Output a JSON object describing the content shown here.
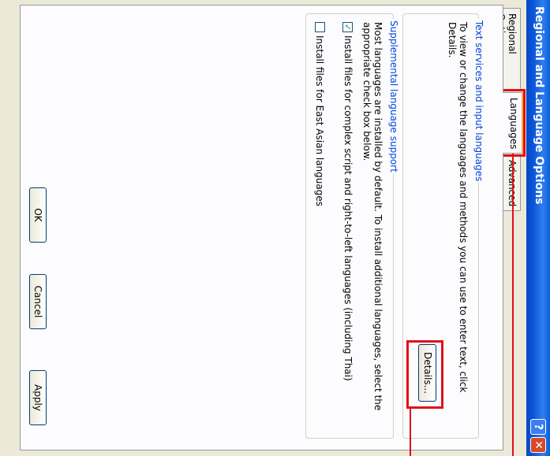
{
  "window": {
    "title": "Regional and Language Options",
    "help_glyph": "?",
    "close_glyph": "✕"
  },
  "tabs": [
    {
      "label": "Regional Options"
    },
    {
      "label": "Languages"
    },
    {
      "label": "Advanced"
    }
  ],
  "text_services": {
    "title": "Text services and input languages",
    "description": "To view or change the languages and methods you can use to enter text, click Details.",
    "details_button": "Details..."
  },
  "supplemental": {
    "title": "Supplemental language support",
    "description": "Most languages are installed by default. To install additional languages, select the appropriate check box below.",
    "complex_script_label": "Install files for complex script and right-to-left languages (including Thai)",
    "complex_script_checked": true,
    "east_asian_label": "Install files for East Asian languages",
    "east_asian_checked": false
  },
  "buttons": {
    "ok": "OK",
    "cancel": "Cancel",
    "apply": "Apply"
  },
  "colors": {
    "highlight": "#e0101a",
    "titlebar": "#0b56d8",
    "group_title": "#0046d5"
  }
}
